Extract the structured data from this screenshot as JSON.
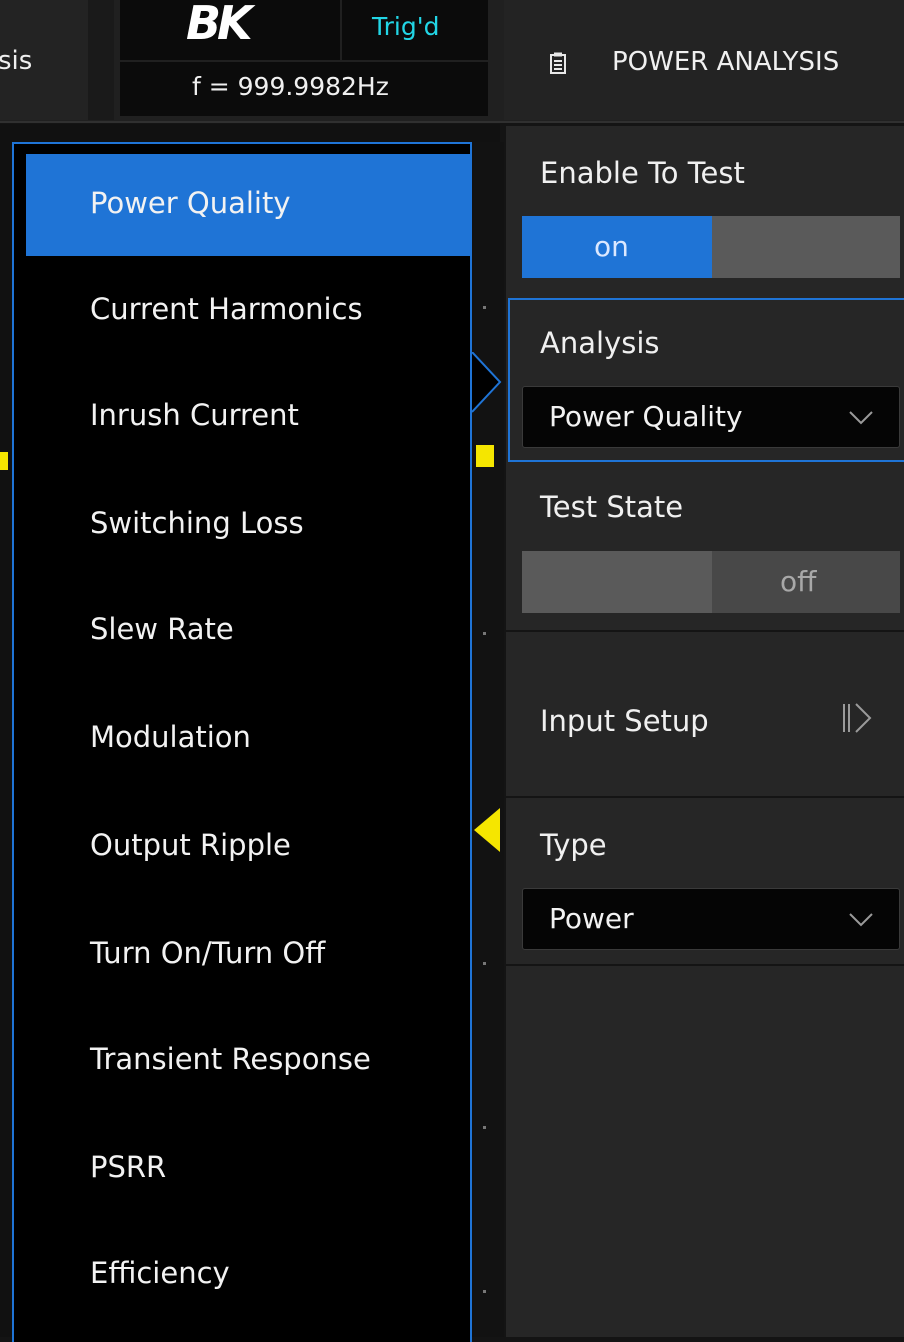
{
  "header": {
    "tab_fragment": "sis",
    "brand": "BK",
    "trigger_status": "Trig'd",
    "frequency": "f = 999.9982Hz",
    "panel_title": "POWER ANALYSIS",
    "panel_icon": "clipboard-icon"
  },
  "analysis_menu": {
    "items": [
      "Power Quality",
      "Current Harmonics",
      "Inrush Current",
      "Switching Loss",
      "Slew Rate",
      "Modulation",
      "Output Ripple",
      "Turn On/Turn Off",
      "Transient Response",
      "PSRR",
      "Efficiency"
    ],
    "selected": "Power Quality"
  },
  "settings": {
    "enable_to_test": {
      "label": "Enable To Test",
      "on_label": "on",
      "value": "on"
    },
    "analysis": {
      "label": "Analysis",
      "value": "Power Quality"
    },
    "test_state": {
      "label": "Test State",
      "off_label": "off",
      "value": "off"
    },
    "input_setup": {
      "label": "Input Setup",
      "icon": "step-forward-icon"
    },
    "type": {
      "label": "Type",
      "value": "Power"
    }
  },
  "colors": {
    "accent": "#1f74d6",
    "trigger_text": "#22d6e6",
    "marker": "#f5e600"
  }
}
